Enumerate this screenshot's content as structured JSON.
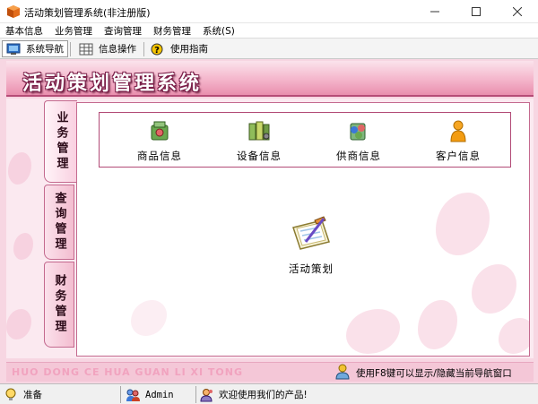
{
  "window": {
    "title": "活动策划管理系统(非注册版)"
  },
  "menu": {
    "items": [
      "基本信息",
      "业务管理",
      "查询管理",
      "财务管理",
      "系统(S)"
    ]
  },
  "toolbar": {
    "buttons": [
      {
        "label": "系统导航",
        "icon": "monitor-icon",
        "active": true
      },
      {
        "label": "信息操作",
        "icon": "grid-icon",
        "active": false
      },
      {
        "label": "使用指南",
        "icon": "help-icon",
        "active": false
      }
    ]
  },
  "header": {
    "title": "活动策划管理系统"
  },
  "nav_tabs": [
    {
      "label": "业务管理",
      "active": true
    },
    {
      "label": "查询管理",
      "active": false
    },
    {
      "label": "财务管理",
      "active": false
    }
  ],
  "functions": [
    {
      "label": "商品信息",
      "icon": "product-icon"
    },
    {
      "label": "设备信息",
      "icon": "equipment-icon"
    },
    {
      "label": "供商信息",
      "icon": "supplier-icon"
    },
    {
      "label": "客户信息",
      "icon": "customer-icon"
    }
  ],
  "center_function": {
    "label": "活动策划",
    "icon": "plan-icon"
  },
  "footer": {
    "pinyin": "HUO DONG CE HUA GUAN LI XI TONG",
    "hint": "使用F8键可以显示/隐藏当前导航窗口"
  },
  "status": {
    "state": "准备",
    "user": "Admin",
    "message": "欢迎使用我们的产品!"
  },
  "colors": {
    "frame_pink": "#f7d6e2",
    "header_border": "#b64d77",
    "panel_border": "#c46a8f"
  }
}
